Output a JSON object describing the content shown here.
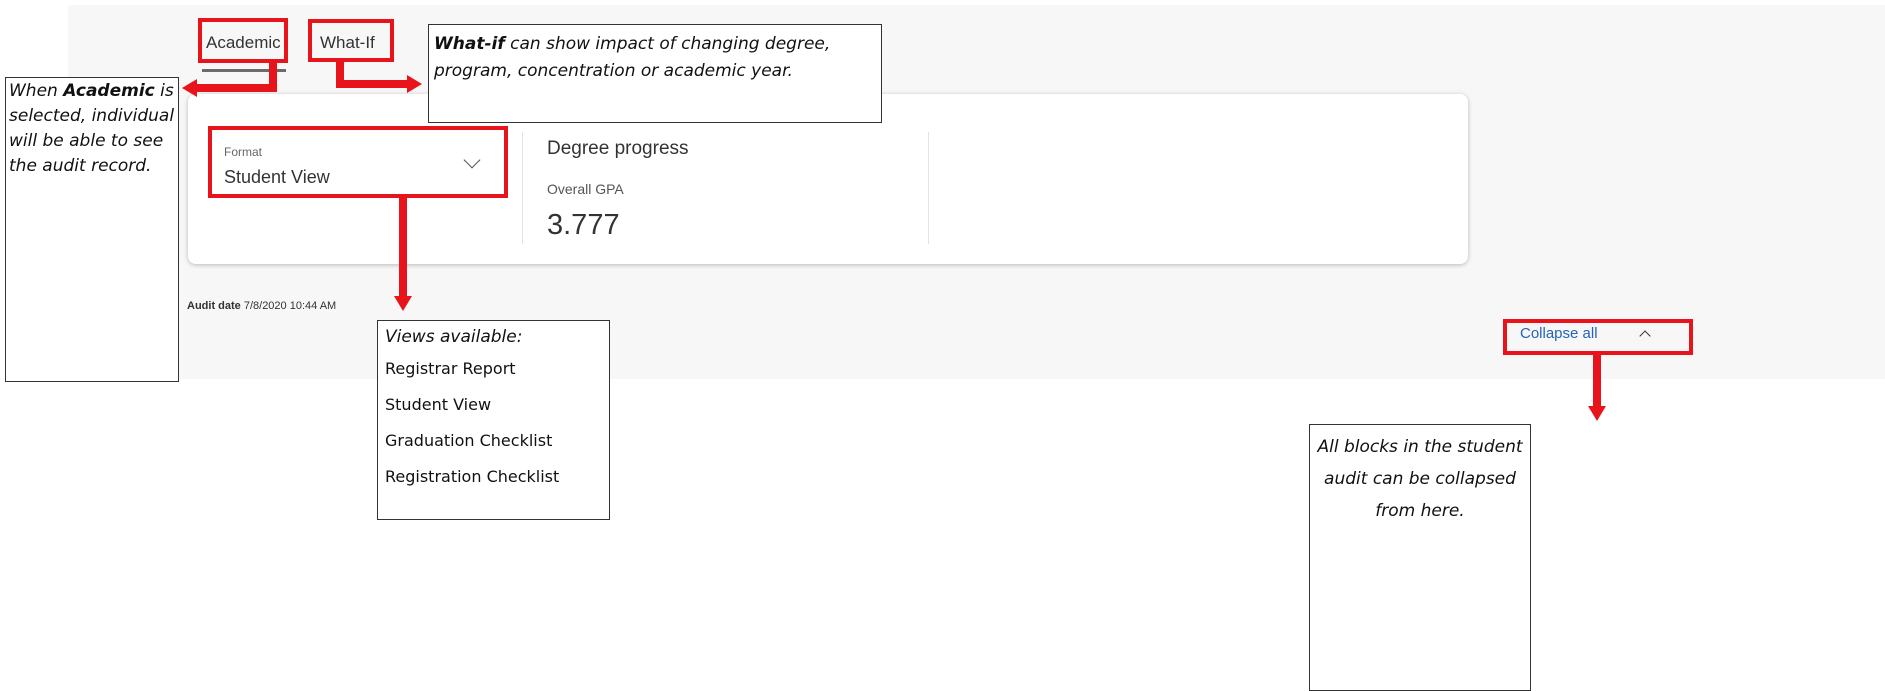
{
  "tabs": [
    {
      "label": "Academic",
      "selected": true
    },
    {
      "label": "What-If",
      "selected": false
    }
  ],
  "format": {
    "label": "Format",
    "value": "Student View"
  },
  "degree_progress": {
    "title": "Degree progress",
    "gpa_label": "Overall GPA",
    "gpa_value": "3.777"
  },
  "audit": {
    "label": "Audit date",
    "value": "7/8/2020 10:44 AM"
  },
  "collapse": {
    "label": "Collapse all"
  },
  "annotations": {
    "whatif": {
      "bold": "What-if",
      "text": "can show impact of changing degree, program, concentration or academic year."
    },
    "academic": {
      "prefix": "When",
      "bold": "Academic",
      "text": "is selected, individual will be able to see the audit record."
    },
    "views": {
      "title": "Views available:",
      "items": [
        "Registrar Report",
        "Student View",
        "Graduation Checklist",
        "Registration Checklist"
      ]
    },
    "collapse": {
      "text": "All blocks in the student audit can be collapsed from here."
    }
  },
  "colors": {
    "highlight": "#e8141b",
    "link": "#2563b8"
  },
  "icons": {
    "format_dropdown": "chevron-down-icon",
    "collapse": "chevron-up-icon"
  }
}
